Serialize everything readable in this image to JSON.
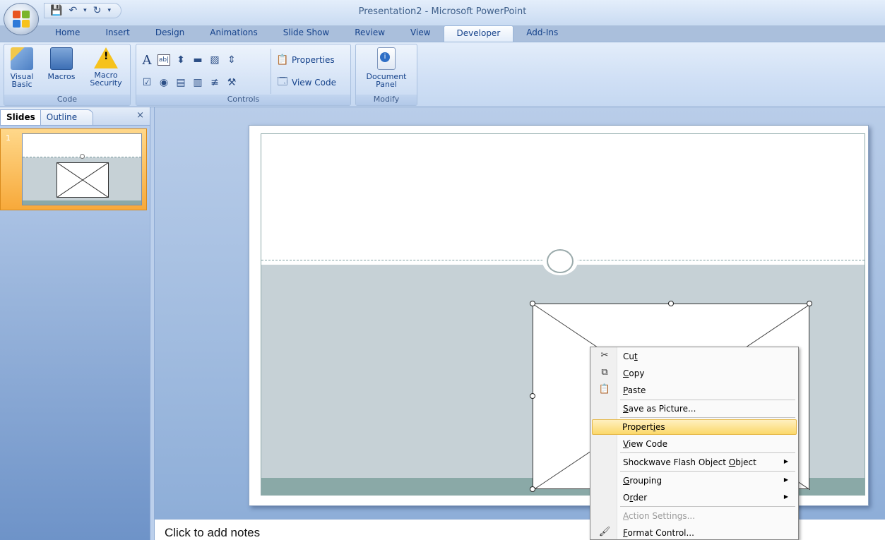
{
  "window": {
    "title": "Presentation2 - Microsoft PowerPoint"
  },
  "qat": {
    "save_icon": "save-icon",
    "undo_icon": "undo-icon",
    "redo_icon": "redo-icon"
  },
  "tabs": [
    "Home",
    "Insert",
    "Design",
    "Animations",
    "Slide Show",
    "Review",
    "View",
    "Developer",
    "Add-Ins"
  ],
  "active_tab": "Developer",
  "ribbon": {
    "code": {
      "label": "Code",
      "visual_basic": "Visual\nBasic",
      "macros": "Macros",
      "macro_security": "Macro\nSecurity"
    },
    "controls": {
      "label": "Controls",
      "properties": "Properties",
      "view_code": "View Code"
    },
    "modify": {
      "label": "Modify",
      "document_panel": "Document\nPanel"
    }
  },
  "panel": {
    "tab_slides": "Slides",
    "tab_outline": "Outline",
    "close": "×",
    "slide_number": "1"
  },
  "notes": {
    "placeholder": "Click to add notes"
  },
  "context_menu": {
    "items": [
      {
        "label_pre": "Cu",
        "label_u": "t",
        "label_post": ""
      },
      {
        "label_pre": "",
        "label_u": "C",
        "label_post": "opy"
      },
      {
        "label_pre": "",
        "label_u": "P",
        "label_post": "aste"
      },
      {
        "label_pre": "",
        "label_u": "S",
        "label_post": "ave as Picture..."
      },
      {
        "label_pre": "Propert",
        "label_u": "i",
        "label_post": "es"
      },
      {
        "label_pre": "",
        "label_u": "V",
        "label_post": "iew Code"
      },
      {
        "label_pre": "Shockwave Flash Object ",
        "label_u": "O",
        "label_post": "bject"
      },
      {
        "label_pre": "",
        "label_u": "G",
        "label_post": "rouping"
      },
      {
        "label_pre": "O",
        "label_u": "r",
        "label_post": "der"
      },
      {
        "label_pre": "",
        "label_u": "A",
        "label_post": "ction Settings..."
      },
      {
        "label_pre": "",
        "label_u": "F",
        "label_post": "ormat Control..."
      }
    ]
  },
  "colors": {
    "accent": "#f7a93a",
    "ribbon": "#cfdff5",
    "highlight": "#fbd86a",
    "slide_band": "#c6d1d6",
    "slide_footer": "#8aa9a7"
  }
}
